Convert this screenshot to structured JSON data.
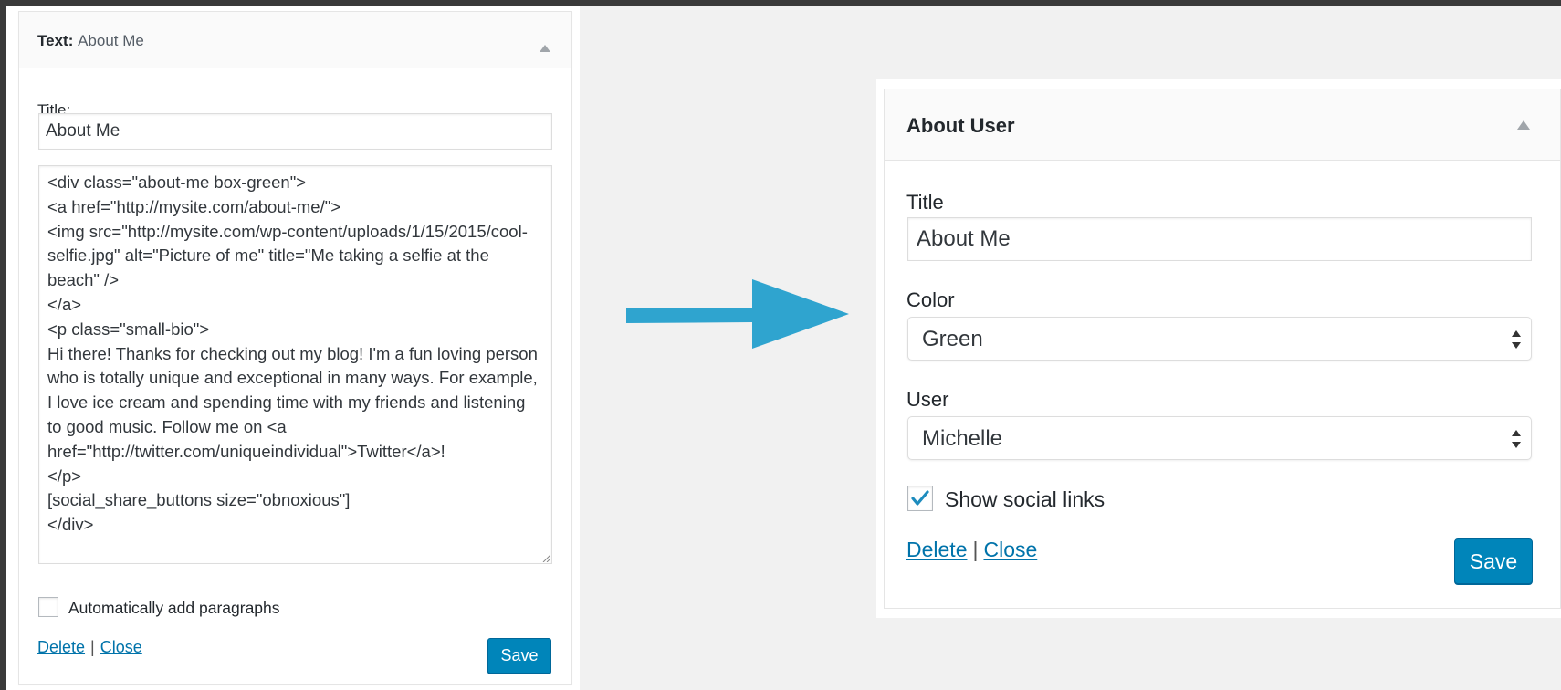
{
  "left_widget": {
    "title_label": "Text:",
    "title_value": "About Me",
    "field_title_label": "Title:",
    "title_input": "About Me",
    "textarea": "<div class=\"about-me box-green\">\n<a href=\"http://mysite.com/about-me/\">\n<img src=\"http://mysite.com/wp-content/uploads/1/15/2015/cool-selfie.jpg\" alt=\"Picture of me\" title=\"Me taking a selfie at the beach\" />\n</a>\n<p class=\"small-bio\">\nHi there! Thanks for checking out my blog! I'm a fun loving person who is totally unique and exceptional in many ways. For example, I love ice cream and spending time with my friends and listening to good music. Follow me on <a href=\"http://twitter.com/uniqueindividual\">Twitter</a>!\n</p>\n[social_share_buttons size=\"obnoxious\"]\n</div>",
    "checkbox_label": "Automatically add paragraphs",
    "checkbox_checked": false,
    "delete_label": "Delete",
    "separator": "|",
    "close_label": "Close",
    "save_label": "Save"
  },
  "right_widget": {
    "title": "About User",
    "title_field_label": "Title",
    "title_input": "About Me",
    "color_label": "Color",
    "color_value": "Green",
    "user_label": "User",
    "user_value": "Michelle",
    "checkbox_label": "Show social links",
    "checkbox_checked": true,
    "delete_label": "Delete",
    "separator": "|",
    "close_label": "Close",
    "save_label": "Save"
  },
  "colors": {
    "accent": "#0085ba",
    "link": "#0073aa",
    "arrow": "#2fa4cf",
    "checkmark": "#1e8cbe"
  },
  "icons": {
    "collapse": "triangle-up-icon",
    "select": "updown-arrows-icon",
    "arrow": "right-arrow-icon",
    "check": "checkmark-icon"
  }
}
